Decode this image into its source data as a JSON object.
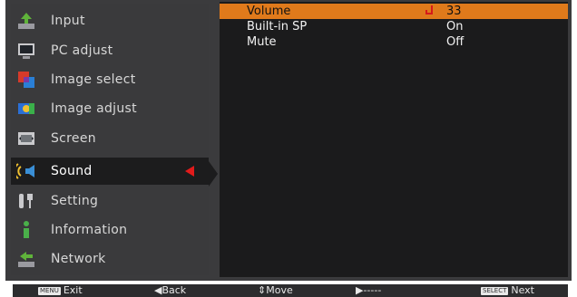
{
  "menu": {
    "items": [
      {
        "label": "Input",
        "icon": "input-icon"
      },
      {
        "label": "PC adjust",
        "icon": "pc-adjust-icon"
      },
      {
        "label": "Image select",
        "icon": "image-select-icon"
      },
      {
        "label": "Image adjust",
        "icon": "image-adjust-icon"
      },
      {
        "label": "Screen",
        "icon": "screen-icon"
      },
      {
        "label": "Sound",
        "icon": "sound-icon",
        "selected": true
      },
      {
        "label": "Setting",
        "icon": "setting-icon"
      },
      {
        "label": "Information",
        "icon": "information-icon"
      },
      {
        "label": "Network",
        "icon": "network-icon"
      }
    ]
  },
  "sound": {
    "rows": [
      {
        "label": "Volume",
        "value": "33",
        "selected": true
      },
      {
        "label": "Built-in SP",
        "value": "On"
      },
      {
        "label": "Mute",
        "value": "Off"
      }
    ]
  },
  "footer": {
    "exit_key": "MENU",
    "exit_label": "Exit",
    "back_label": "◀Back",
    "move_label": "⇕Move",
    "forward_label": "▶-----",
    "next_key": "SELECT",
    "next_label": "Next"
  },
  "colors": {
    "highlight": "#e07a1b",
    "accent_red": "#e21b1b",
    "panel": "#3a3a3c",
    "selected_bg": "#1c1c1d"
  }
}
